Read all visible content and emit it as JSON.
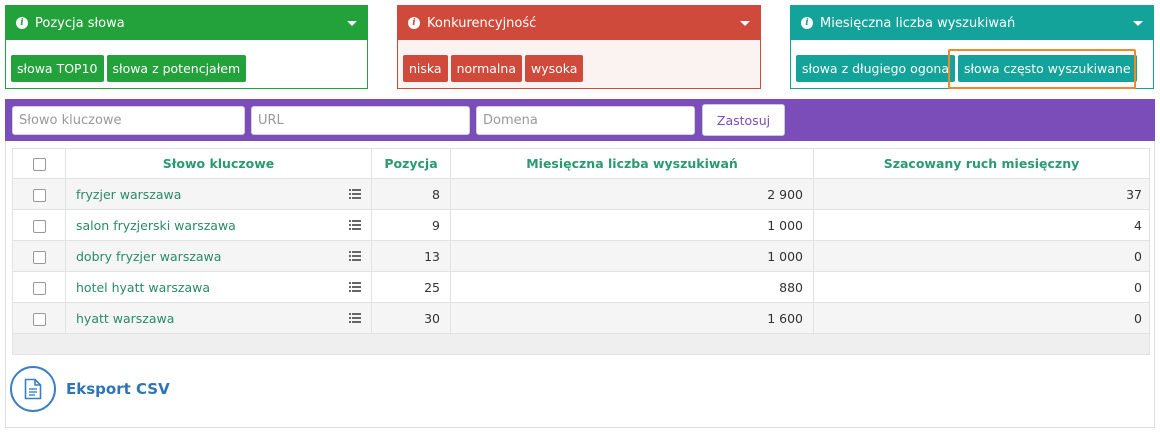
{
  "panels": {
    "position": {
      "title": "Pozycja słowa",
      "color": "#23a13a",
      "chips": [
        "słowa TOP10",
        "słowa z potencjałem"
      ]
    },
    "competition": {
      "title": "Konkurencyjność",
      "color": "#cf4a3a",
      "chips": [
        "niska",
        "normalna",
        "wysoka"
      ]
    },
    "monthly_searches": {
      "title": "Miesięczna liczba wyszukiwań",
      "color": "#14a39a",
      "chips": [
        "słowa z długiego ogona",
        "słowa często wyszukiwane"
      ],
      "highlighted_chip": "słowa często wyszukiwane"
    }
  },
  "filters": {
    "keyword_placeholder": "Słowo kluczowe",
    "url_placeholder": "URL",
    "domain_placeholder": "Domena",
    "apply_label": "Zastosuj",
    "bar_color": "#7b4db8"
  },
  "table": {
    "headers": {
      "keyword": "Słowo kluczowe",
      "position": "Pozycja",
      "monthly_searches": "Miesięczna liczba wyszukiwań",
      "traffic": "Szacowany ruch miesięczny"
    },
    "rows": [
      {
        "keyword": "fryzjer warszawa",
        "position": "8",
        "monthly_searches": "2 900",
        "traffic": "37"
      },
      {
        "keyword": "salon fryzjerski warszawa",
        "position": "9",
        "monthly_searches": "1 000",
        "traffic": "4"
      },
      {
        "keyword": "dobry fryzjer warszawa",
        "position": "13",
        "monthly_searches": "1 000",
        "traffic": "0"
      },
      {
        "keyword": "hotel hyatt warszawa",
        "position": "25",
        "monthly_searches": "880",
        "traffic": "0"
      },
      {
        "keyword": "hyatt warszawa",
        "position": "30",
        "monthly_searches": "1 600",
        "traffic": "0"
      }
    ]
  },
  "export": {
    "label": "Eksport CSV",
    "icon": "document-icon"
  }
}
